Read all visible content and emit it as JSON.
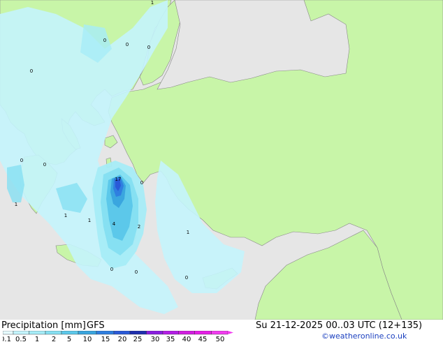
{
  "footer": {
    "title": "Precipitation [mm]",
    "model": "GFS",
    "valid": "Su 21-12-2025 00..03 UTC (12+135)",
    "credit": "©weatheronline.co.uk"
  },
  "legend": {
    "ticks": [
      "0.1",
      "0.5",
      "1",
      "2",
      "5",
      "10",
      "15",
      "20",
      "25",
      "30",
      "35",
      "40",
      "45",
      "50"
    ],
    "colors": [
      "#e6fbff",
      "#c4f4fc",
      "#a6ecf7",
      "#86e0f2",
      "#5cc8ea",
      "#3aa6df",
      "#2f7fe0",
      "#2a5ad8",
      "#1f2fae",
      "#8a1ee0",
      "#b41ee6",
      "#d21ee0",
      "#e51ee6",
      "#f23cf0"
    ]
  },
  "map": {
    "land_color": "#c8f5a8",
    "sea_color": "#e6e6e6",
    "point_labels": [
      {
        "text": "1",
        "where": "north Aegean top"
      },
      {
        "text": "0",
        "where": "Thrace"
      },
      {
        "text": "0",
        "where": "Bulgaria coast"
      },
      {
        "text": "0",
        "where": "Istanbul"
      },
      {
        "text": "0",
        "where": "north Greece"
      },
      {
        "text": "0",
        "where": "central Greece"
      },
      {
        "text": "0",
        "where": "Euboea"
      },
      {
        "text": "17",
        "where": "Dodecanese north"
      },
      {
        "text": "0",
        "where": "Anatolia coast"
      },
      {
        "text": "1",
        "where": "Peloponnese"
      },
      {
        "text": "1",
        "where": "Cyclades west"
      },
      {
        "text": "1",
        "where": "Cyclades south"
      },
      {
        "text": "4",
        "where": "Kos area"
      },
      {
        "text": "2",
        "where": "Rhodes"
      },
      {
        "text": "1",
        "where": "Levantine sea"
      },
      {
        "text": "0",
        "where": "south of Crete"
      },
      {
        "text": "0",
        "where": "south of Rhodes"
      },
      {
        "text": "0",
        "where": "west of Cyprus"
      }
    ]
  }
}
